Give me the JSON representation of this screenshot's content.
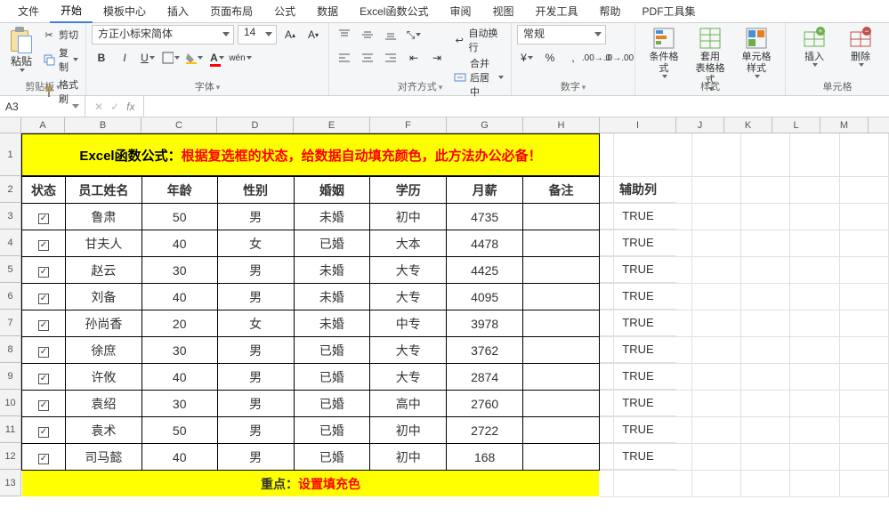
{
  "tabs": [
    "文件",
    "开始",
    "模板中心",
    "插入",
    "页面布局",
    "公式",
    "数据",
    "Excel函数公式",
    "审阅",
    "视图",
    "开发工具",
    "帮助",
    "PDF工具集"
  ],
  "active_tab": 1,
  "clip": {
    "paste": "粘贴",
    "cut": "剪切",
    "copy": "复制",
    "fmtpaint": "格式刷",
    "label": "剪贴板"
  },
  "font": {
    "name": "方正小标宋简体",
    "size": "14",
    "label": "字体"
  },
  "align": {
    "wrap": "自动换行",
    "merge": "合并后居中",
    "label": "对齐方式"
  },
  "number": {
    "fmt": "常规",
    "label": "数字"
  },
  "styles": {
    "cond": "条件格式",
    "tbl": "套用\n表格格式",
    "cell": "单元格样式",
    "label": "样式"
  },
  "cells": {
    "ins": "插入",
    "del": "删除",
    "label": "单元格"
  },
  "name_box": "A3",
  "banner_black": "Excel函数公式：",
  "banner_red": "根据复选框的状态，给数据自动填充颜色，此方法办公必备！",
  "headers": [
    "状态",
    "员工姓名",
    "年龄",
    "性别",
    "婚姻",
    "学历",
    "月薪",
    "备注"
  ],
  "aux_header": "辅助列",
  "data_rows": [
    {
      "chk": true,
      "name": "鲁肃",
      "age": "50",
      "sex": "男",
      "mar": "未婚",
      "edu": "初中",
      "sal": "4735",
      "note": "",
      "aux": "TRUE"
    },
    {
      "chk": true,
      "name": "甘夫人",
      "age": "40",
      "sex": "女",
      "mar": "已婚",
      "edu": "大本",
      "sal": "4478",
      "note": "",
      "aux": "TRUE"
    },
    {
      "chk": true,
      "name": "赵云",
      "age": "30",
      "sex": "男",
      "mar": "未婚",
      "edu": "大专",
      "sal": "4425",
      "note": "",
      "aux": "TRUE"
    },
    {
      "chk": true,
      "name": "刘备",
      "age": "40",
      "sex": "男",
      "mar": "未婚",
      "edu": "大专",
      "sal": "4095",
      "note": "",
      "aux": "TRUE"
    },
    {
      "chk": true,
      "name": "孙尚香",
      "age": "20",
      "sex": "女",
      "mar": "未婚",
      "edu": "中专",
      "sal": "3978",
      "note": "",
      "aux": "TRUE"
    },
    {
      "chk": true,
      "name": "徐庶",
      "age": "30",
      "sex": "男",
      "mar": "已婚",
      "edu": "大专",
      "sal": "3762",
      "note": "",
      "aux": "TRUE"
    },
    {
      "chk": true,
      "name": "许攸",
      "age": "40",
      "sex": "男",
      "mar": "已婚",
      "edu": "大专",
      "sal": "2874",
      "note": "",
      "aux": "TRUE"
    },
    {
      "chk": true,
      "name": "袁绍",
      "age": "30",
      "sex": "男",
      "mar": "已婚",
      "edu": "高中",
      "sal": "2760",
      "note": "",
      "aux": "TRUE"
    },
    {
      "chk": true,
      "name": "袁术",
      "age": "50",
      "sex": "男",
      "mar": "已婚",
      "edu": "初中",
      "sal": "2722",
      "note": "",
      "aux": "TRUE"
    },
    {
      "chk": true,
      "name": "司马懿",
      "age": "40",
      "sex": "男",
      "mar": "已婚",
      "edu": "初中",
      "sal": "168",
      "note": "",
      "aux": "TRUE"
    }
  ],
  "footer_black": "重点：",
  "footer_red": "设置填充色",
  "col_letters": [
    "A",
    "B",
    "C",
    "D",
    "E",
    "F",
    "G",
    "H",
    "I",
    "J",
    "K",
    "L",
    "M"
  ],
  "row_nums": [
    "1",
    "2",
    "3",
    "4",
    "5",
    "6",
    "7",
    "8",
    "9",
    "10",
    "11",
    "12",
    "13"
  ]
}
